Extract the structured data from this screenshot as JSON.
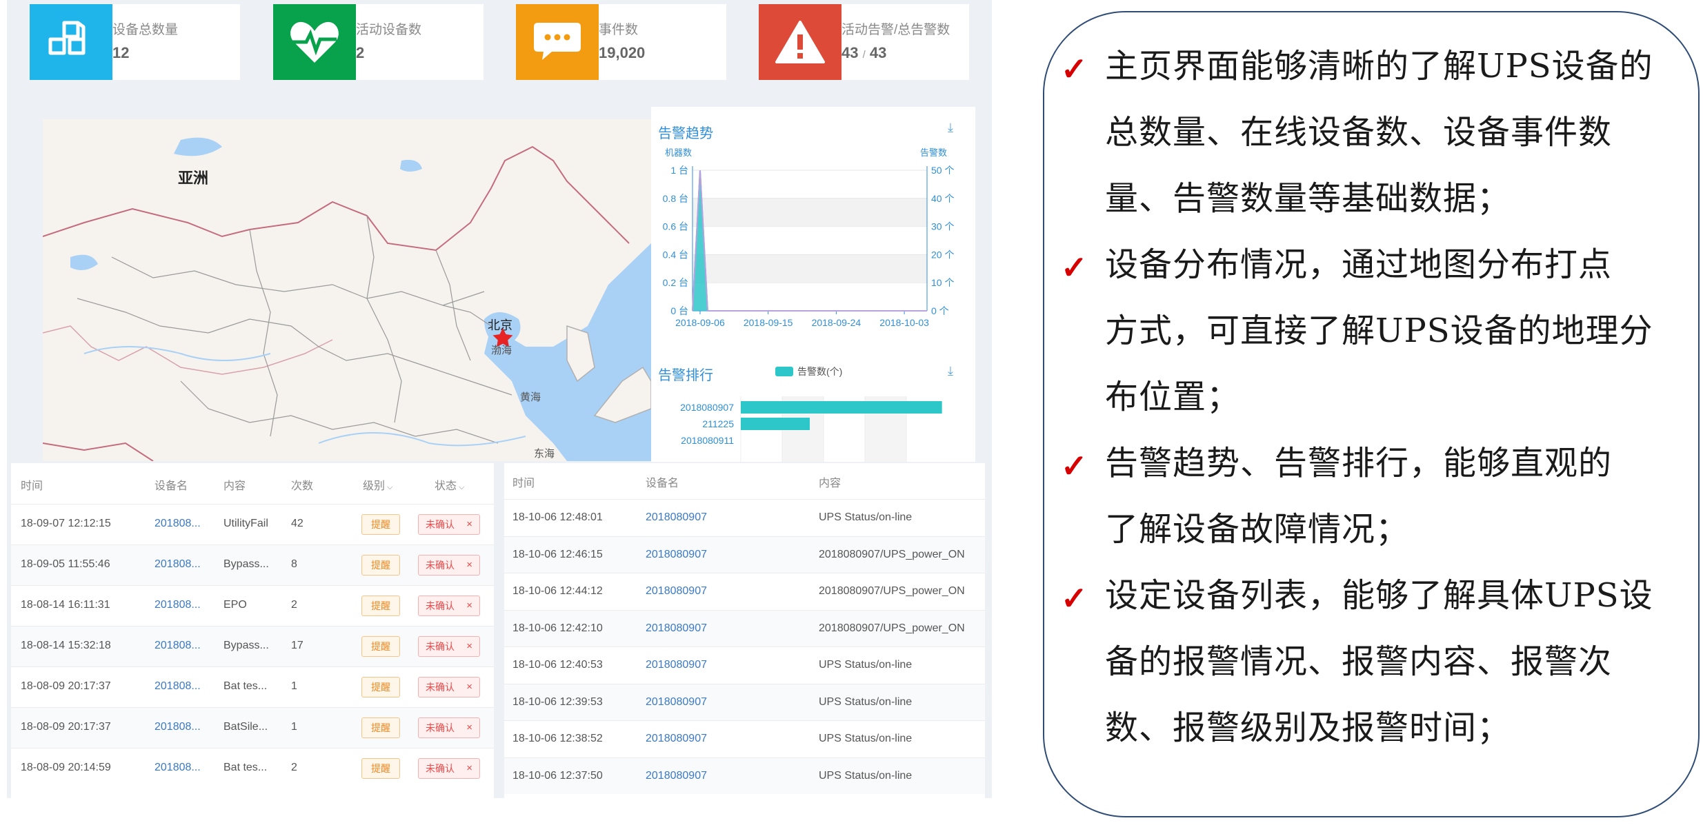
{
  "stats": [
    {
      "label": "设备总数量",
      "value": "12",
      "color": "#1fb5ea",
      "icon": "cubes-icon"
    },
    {
      "label": "活动设备数",
      "value": "2",
      "color": "#08a24c",
      "icon": "heart-pulse-icon"
    },
    {
      "label": "事件数",
      "value": "19,020",
      "color": "#f39c12",
      "icon": "chat-bubble-icon"
    },
    {
      "label": "活动告警/总告警数",
      "value_active": "43",
      "value_sep": "/",
      "value_total": "43",
      "color": "#de4a38",
      "icon": "warning-icon"
    }
  ],
  "map": {
    "continent_label": "亚洲",
    "capital_label": "北京",
    "sea_labels": [
      "渤海",
      "黄海",
      "东海"
    ]
  },
  "trend": {
    "title": "告警趋势",
    "left_axis_title": "机器数",
    "right_axis_title": "告警数"
  },
  "ranking": {
    "title": "告警排行",
    "legend": "告警数(个)"
  },
  "chart_data": [
    {
      "type": "line",
      "title": "告警趋势",
      "x": [
        "2018-09-06",
        "2018-09-15",
        "2018-09-24",
        "2018-10-03"
      ],
      "y_left_ticks": [
        "0 台",
        "0.2 台",
        "0.4 台",
        "0.6 台",
        "0.8 台",
        "1 台"
      ],
      "y_right_ticks": [
        "0 个",
        "10 个",
        "20 个",
        "30 个",
        "40 个",
        "50 个"
      ],
      "ylim_left": [
        0,
        1
      ],
      "ylim_right": [
        0,
        50
      ],
      "series": [
        {
          "name": "机器数",
          "points": [
            [
              "2018-09-05",
              0
            ],
            [
              "2018-09-06",
              1
            ],
            [
              "2018-09-07",
              0
            ]
          ],
          "color": "#2ec7c9"
        },
        {
          "name": "告警数",
          "points": [
            [
              "2018-09-05",
              0
            ],
            [
              "2018-09-06",
              50
            ],
            [
              "2018-09-07",
              0
            ],
            [
              "2018-10-06",
              0
            ]
          ],
          "color": "#b6a2de"
        }
      ]
    },
    {
      "type": "bar",
      "title": "告警排行",
      "orientation": "horizontal",
      "categories": [
        "2018080907",
        "211225",
        "2018080911"
      ],
      "series": [
        {
          "name": "告警数(个)",
          "values": [
            35,
            12,
            0
          ]
        }
      ],
      "color": "#2ec7c9"
    }
  ],
  "alarm_table": {
    "headers": [
      "时间",
      "设备名",
      "内容",
      "次数",
      "级别",
      "状态"
    ],
    "rows": [
      {
        "time": "18-09-07 12:12:15",
        "device": "201808...",
        "content": "UtilityFail",
        "count": "42",
        "level": "提醒",
        "status": "未确认"
      },
      {
        "time": "18-09-05 11:55:46",
        "device": "201808...",
        "content": "Bypass...",
        "count": "8",
        "level": "提醒",
        "status": "未确认"
      },
      {
        "time": "18-08-14 16:11:31",
        "device": "201808...",
        "content": "EPO",
        "count": "2",
        "level": "提醒",
        "status": "未确认"
      },
      {
        "time": "18-08-14 15:32:18",
        "device": "201808...",
        "content": "Bypass...",
        "count": "17",
        "level": "提醒",
        "status": "未确认"
      },
      {
        "time": "18-08-09 20:17:37",
        "device": "201808...",
        "content": "Bat tes...",
        "count": "1",
        "level": "提醒",
        "status": "未确认"
      },
      {
        "time": "18-08-09 20:17:37",
        "device": "201808...",
        "content": "BatSile...",
        "count": "1",
        "level": "提醒",
        "status": "未确认"
      },
      {
        "time": "18-08-09 20:14:59",
        "device": "201808...",
        "content": "Bat tes...",
        "count": "2",
        "level": "提醒",
        "status": "未确认"
      }
    ]
  },
  "event_table": {
    "headers": [
      "时间",
      "设备名",
      "内容"
    ],
    "rows": [
      {
        "time": "18-10-06 12:48:01",
        "device": "2018080907",
        "content": "UPS Status/on-line"
      },
      {
        "time": "18-10-06 12:46:15",
        "device": "2018080907",
        "content": "2018080907/UPS_power_ON"
      },
      {
        "time": "18-10-06 12:44:12",
        "device": "2018080907",
        "content": "2018080907/UPS_power_ON"
      },
      {
        "time": "18-10-06 12:42:10",
        "device": "2018080907",
        "content": "2018080907/UPS_power_ON"
      },
      {
        "time": "18-10-06 12:40:53",
        "device": "2018080907",
        "content": "UPS Status/on-line"
      },
      {
        "time": "18-10-06 12:39:53",
        "device": "2018080907",
        "content": "UPS Status/on-line"
      },
      {
        "time": "18-10-06 12:38:52",
        "device": "2018080907",
        "content": "UPS Status/on-line"
      },
      {
        "time": "18-10-06 12:37:50",
        "device": "2018080907",
        "content": "UPS Status/on-line"
      }
    ]
  },
  "notes": [
    {
      "lines": [
        "主页界面能够清晰的了解UPS设备的",
        "总数量、在线设备数、设备事件数",
        "量、告警数量等基础数据；"
      ]
    },
    {
      "lines": [
        "设备分布情况，通过地图分布打点",
        "方式，可直接了解UPS设备的地理分",
        "布位置；"
      ]
    },
    {
      "lines": [
        "告警趋势、告警排行，能够直观的",
        "了解设备故障情况；"
      ]
    },
    {
      "lines": [
        "设定设备列表，能够了解具体UPS设",
        "备的报警情况、报警内容、报警次",
        "数、报警级别及报警时间；"
      ]
    }
  ]
}
